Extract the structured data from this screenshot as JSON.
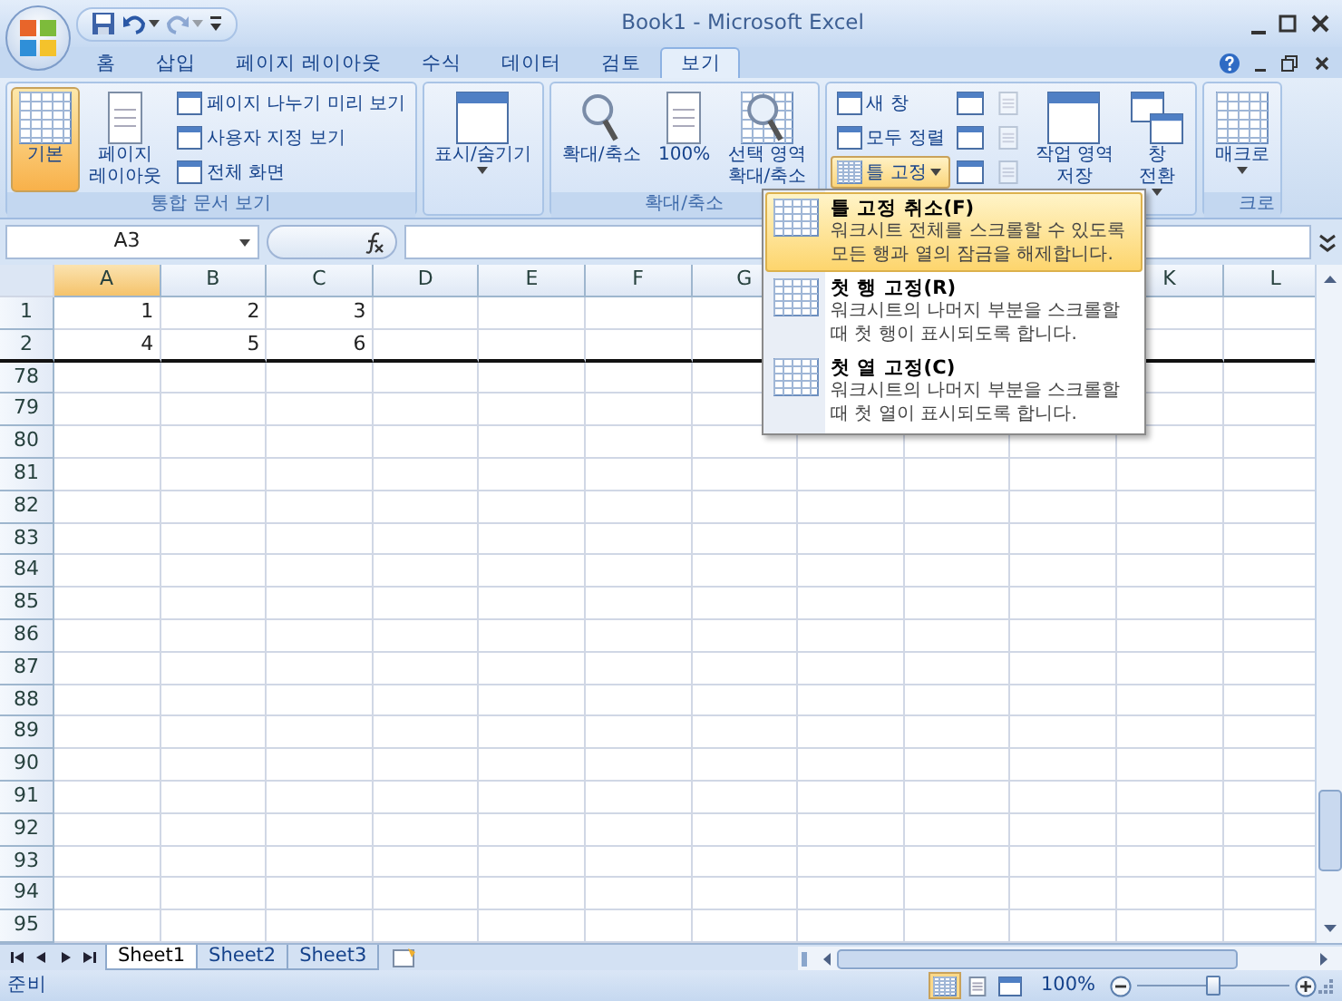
{
  "window": {
    "title": "Book1 - Microsoft Excel"
  },
  "quick_access": [
    {
      "kind": "save",
      "disabled": false
    },
    {
      "kind": "undo",
      "disabled": false
    },
    {
      "kind": "redo",
      "disabled": true
    },
    {
      "kind": "customize",
      "disabled": false
    }
  ],
  "ribbon_tabs": [
    {
      "label": "홈",
      "selected": false
    },
    {
      "label": "삽입",
      "selected": false
    },
    {
      "label": "페이지 레이아웃",
      "selected": false
    },
    {
      "label": "수식",
      "selected": false
    },
    {
      "label": "데이터",
      "selected": false
    },
    {
      "label": "검토",
      "selected": false
    },
    {
      "label": "보기",
      "selected": true
    }
  ],
  "ribbon_groups": [
    {
      "label": "통합 문서 보기",
      "controls": [
        {
          "kind": "large",
          "label": "기본",
          "selected": true
        },
        {
          "kind": "large",
          "label": "페이지\n레이아웃",
          "selected": false
        },
        {
          "kind": "small",
          "label": "페이지 나누기 미리 보기"
        },
        {
          "kind": "small",
          "label": "사용자 지정 보기"
        },
        {
          "kind": "small",
          "label": "전체 화면"
        }
      ]
    },
    {
      "controls": [
        {
          "kind": "large",
          "label": "표시/숨기기",
          "dropdown": true
        }
      ]
    },
    {
      "label": "확대/축소",
      "controls": [
        {
          "kind": "large",
          "label": "확대/축소"
        },
        {
          "kind": "large",
          "label": "100%"
        },
        {
          "kind": "large",
          "label": "선택 영역\n확대/축소"
        }
      ]
    },
    {
      "controls": [
        {
          "kind": "small",
          "label": "새 창"
        },
        {
          "kind": "small",
          "label": "모두 정렬"
        },
        {
          "kind": "small",
          "label": "틀 고정",
          "dropdown": true,
          "expanded": true
        },
        {
          "kind": "icon",
          "disabled": false
        },
        {
          "kind": "icon",
          "disabled": false
        },
        {
          "kind": "icon",
          "disabled": false
        },
        {
          "kind": "icon",
          "disabled": true
        },
        {
          "kind": "icon",
          "disabled": true
        },
        {
          "kind": "icon",
          "disabled": true
        },
        {
          "kind": "large",
          "label": "작업 영역\n저장"
        },
        {
          "kind": "large",
          "label": "창\n전환",
          "dropdown": true
        }
      ]
    },
    {
      "label": "크로",
      "controls": [
        {
          "kind": "large",
          "label": "매크로",
          "dropdown": true
        }
      ]
    }
  ],
  "formula_bar": {
    "name_box": "A3"
  },
  "columns": [
    {
      "label": "A",
      "selected": true
    },
    {
      "label": "B",
      "selected": false
    },
    {
      "label": "C",
      "selected": false
    },
    {
      "label": "D",
      "selected": false
    },
    {
      "label": "E",
      "selected": false
    },
    {
      "label": "F",
      "selected": false
    },
    {
      "label": "G",
      "selected": false
    },
    {},
    {},
    {},
    {
      "label": "K",
      "selected": false
    },
    {
      "label": "L",
      "selected": false
    }
  ],
  "rows": [
    {
      "label": "1",
      "freeze_line": false,
      "cells": [
        "1",
        "2",
        "3"
      ]
    },
    {
      "label": "2",
      "freeze_line": true,
      "cells": [
        "4",
        "5",
        "6"
      ]
    },
    {
      "label": "78",
      "freeze_line": false
    },
    {
      "label": "79",
      "freeze_line": false
    },
    {
      "label": "80",
      "freeze_line": false
    },
    {
      "label": "81",
      "freeze_line": false
    },
    {
      "label": "82",
      "freeze_line": false
    },
    {
      "label": "83",
      "freeze_line": false
    },
    {
      "label": "84",
      "freeze_line": false
    },
    {
      "label": "85",
      "freeze_line": false
    },
    {
      "label": "86",
      "freeze_line": false
    },
    {
      "label": "87",
      "freeze_line": false
    },
    {
      "label": "88",
      "freeze_line": false
    },
    {
      "label": "89",
      "freeze_line": false
    },
    {
      "label": "90",
      "freeze_line": false
    },
    {
      "label": "91",
      "freeze_line": false
    },
    {
      "label": "92",
      "freeze_line": false
    },
    {
      "label": "93",
      "freeze_line": false
    },
    {
      "label": "94",
      "freeze_line": false
    },
    {
      "label": "95",
      "freeze_line": false
    }
  ],
  "freeze_menu": [
    {
      "title": "틀 고정 취소(F)",
      "description": "워크시트 전체를 스크롤할 수 있도록 모든 행과 열의 잠금을 해제합니다.",
      "selected": true
    },
    {
      "title": "첫 행 고정(R)",
      "description": "워크시트의 나머지 부분을 스크롤할 때 첫 행이 표시되도록 합니다.",
      "selected": false
    },
    {
      "title": "첫 열 고정(C)",
      "description": "워크시트의 나머지 부분을 스크롤할 때 첫 열이 표시되도록 합니다.",
      "selected": false
    }
  ],
  "sheet_tabs": [
    {
      "label": "Sheet1",
      "selected": true
    },
    {
      "label": "Sheet2",
      "selected": false
    },
    {
      "label": "Sheet3",
      "selected": false
    }
  ],
  "status_bar": {
    "status": "준비",
    "views": [
      {
        "selected": true
      },
      {
        "selected": false
      },
      {
        "selected": false
      }
    ],
    "zoom": {
      "reading": "100%",
      "level": 0.5
    }
  }
}
